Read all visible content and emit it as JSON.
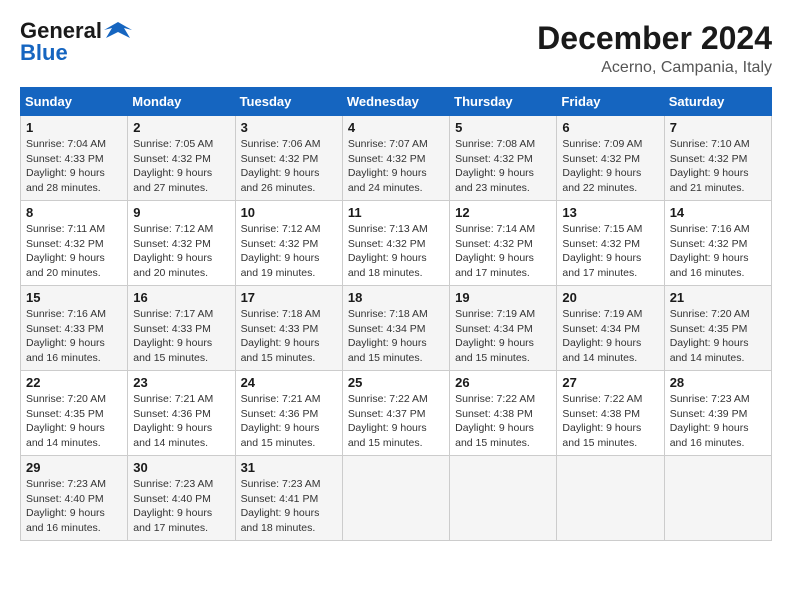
{
  "header": {
    "logo_line1": "General",
    "logo_line2": "Blue",
    "month_year": "December 2024",
    "location": "Acerno, Campania, Italy"
  },
  "columns": [
    "Sunday",
    "Monday",
    "Tuesday",
    "Wednesday",
    "Thursday",
    "Friday",
    "Saturday"
  ],
  "weeks": [
    [
      {
        "day": "1",
        "sunrise": "Sunrise: 7:04 AM",
        "sunset": "Sunset: 4:33 PM",
        "daylight": "Daylight: 9 hours and 28 minutes."
      },
      {
        "day": "2",
        "sunrise": "Sunrise: 7:05 AM",
        "sunset": "Sunset: 4:32 PM",
        "daylight": "Daylight: 9 hours and 27 minutes."
      },
      {
        "day": "3",
        "sunrise": "Sunrise: 7:06 AM",
        "sunset": "Sunset: 4:32 PM",
        "daylight": "Daylight: 9 hours and 26 minutes."
      },
      {
        "day": "4",
        "sunrise": "Sunrise: 7:07 AM",
        "sunset": "Sunset: 4:32 PM",
        "daylight": "Daylight: 9 hours and 24 minutes."
      },
      {
        "day": "5",
        "sunrise": "Sunrise: 7:08 AM",
        "sunset": "Sunset: 4:32 PM",
        "daylight": "Daylight: 9 hours and 23 minutes."
      },
      {
        "day": "6",
        "sunrise": "Sunrise: 7:09 AM",
        "sunset": "Sunset: 4:32 PM",
        "daylight": "Daylight: 9 hours and 22 minutes."
      },
      {
        "day": "7",
        "sunrise": "Sunrise: 7:10 AM",
        "sunset": "Sunset: 4:32 PM",
        "daylight": "Daylight: 9 hours and 21 minutes."
      }
    ],
    [
      {
        "day": "8",
        "sunrise": "Sunrise: 7:11 AM",
        "sunset": "Sunset: 4:32 PM",
        "daylight": "Daylight: 9 hours and 20 minutes."
      },
      {
        "day": "9",
        "sunrise": "Sunrise: 7:12 AM",
        "sunset": "Sunset: 4:32 PM",
        "daylight": "Daylight: 9 hours and 20 minutes."
      },
      {
        "day": "10",
        "sunrise": "Sunrise: 7:12 AM",
        "sunset": "Sunset: 4:32 PM",
        "daylight": "Daylight: 9 hours and 19 minutes."
      },
      {
        "day": "11",
        "sunrise": "Sunrise: 7:13 AM",
        "sunset": "Sunset: 4:32 PM",
        "daylight": "Daylight: 9 hours and 18 minutes."
      },
      {
        "day": "12",
        "sunrise": "Sunrise: 7:14 AM",
        "sunset": "Sunset: 4:32 PM",
        "daylight": "Daylight: 9 hours and 17 minutes."
      },
      {
        "day": "13",
        "sunrise": "Sunrise: 7:15 AM",
        "sunset": "Sunset: 4:32 PM",
        "daylight": "Daylight: 9 hours and 17 minutes."
      },
      {
        "day": "14",
        "sunrise": "Sunrise: 7:16 AM",
        "sunset": "Sunset: 4:32 PM",
        "daylight": "Daylight: 9 hours and 16 minutes."
      }
    ],
    [
      {
        "day": "15",
        "sunrise": "Sunrise: 7:16 AM",
        "sunset": "Sunset: 4:33 PM",
        "daylight": "Daylight: 9 hours and 16 minutes."
      },
      {
        "day": "16",
        "sunrise": "Sunrise: 7:17 AM",
        "sunset": "Sunset: 4:33 PM",
        "daylight": "Daylight: 9 hours and 15 minutes."
      },
      {
        "day": "17",
        "sunrise": "Sunrise: 7:18 AM",
        "sunset": "Sunset: 4:33 PM",
        "daylight": "Daylight: 9 hours and 15 minutes."
      },
      {
        "day": "18",
        "sunrise": "Sunrise: 7:18 AM",
        "sunset": "Sunset: 4:34 PM",
        "daylight": "Daylight: 9 hours and 15 minutes."
      },
      {
        "day": "19",
        "sunrise": "Sunrise: 7:19 AM",
        "sunset": "Sunset: 4:34 PM",
        "daylight": "Daylight: 9 hours and 15 minutes."
      },
      {
        "day": "20",
        "sunrise": "Sunrise: 7:19 AM",
        "sunset": "Sunset: 4:34 PM",
        "daylight": "Daylight: 9 hours and 14 minutes."
      },
      {
        "day": "21",
        "sunrise": "Sunrise: 7:20 AM",
        "sunset": "Sunset: 4:35 PM",
        "daylight": "Daylight: 9 hours and 14 minutes."
      }
    ],
    [
      {
        "day": "22",
        "sunrise": "Sunrise: 7:20 AM",
        "sunset": "Sunset: 4:35 PM",
        "daylight": "Daylight: 9 hours and 14 minutes."
      },
      {
        "day": "23",
        "sunrise": "Sunrise: 7:21 AM",
        "sunset": "Sunset: 4:36 PM",
        "daylight": "Daylight: 9 hours and 14 minutes."
      },
      {
        "day": "24",
        "sunrise": "Sunrise: 7:21 AM",
        "sunset": "Sunset: 4:36 PM",
        "daylight": "Daylight: 9 hours and 15 minutes."
      },
      {
        "day": "25",
        "sunrise": "Sunrise: 7:22 AM",
        "sunset": "Sunset: 4:37 PM",
        "daylight": "Daylight: 9 hours and 15 minutes."
      },
      {
        "day": "26",
        "sunrise": "Sunrise: 7:22 AM",
        "sunset": "Sunset: 4:38 PM",
        "daylight": "Daylight: 9 hours and 15 minutes."
      },
      {
        "day": "27",
        "sunrise": "Sunrise: 7:22 AM",
        "sunset": "Sunset: 4:38 PM",
        "daylight": "Daylight: 9 hours and 15 minutes."
      },
      {
        "day": "28",
        "sunrise": "Sunrise: 7:23 AM",
        "sunset": "Sunset: 4:39 PM",
        "daylight": "Daylight: 9 hours and 16 minutes."
      }
    ],
    [
      {
        "day": "29",
        "sunrise": "Sunrise: 7:23 AM",
        "sunset": "Sunset: 4:40 PM",
        "daylight": "Daylight: 9 hours and 16 minutes."
      },
      {
        "day": "30",
        "sunrise": "Sunrise: 7:23 AM",
        "sunset": "Sunset: 4:40 PM",
        "daylight": "Daylight: 9 hours and 17 minutes."
      },
      {
        "day": "31",
        "sunrise": "Sunrise: 7:23 AM",
        "sunset": "Sunset: 4:41 PM",
        "daylight": "Daylight: 9 hours and 18 minutes."
      },
      null,
      null,
      null,
      null
    ]
  ]
}
